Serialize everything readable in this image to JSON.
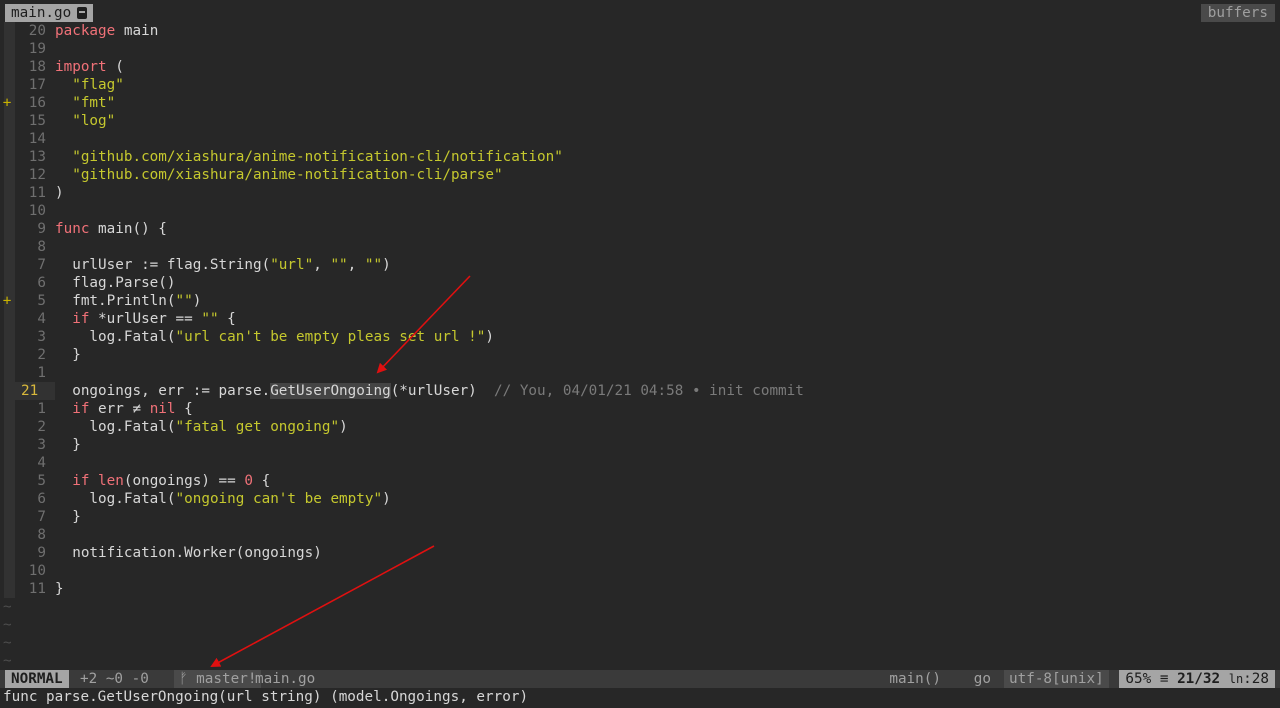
{
  "tabline": {
    "tab_label": "main.go",
    "buffers_label": "buffers"
  },
  "lines": [
    {
      "num": "20",
      "tokens": [
        {
          "t": "package",
          "c": "kw"
        },
        {
          "t": " main",
          "c": "fn"
        }
      ]
    },
    {
      "num": "19",
      "tokens": []
    },
    {
      "num": "18",
      "tokens": [
        {
          "t": "import",
          "c": "kw"
        },
        {
          "t": " (",
          "c": "fn"
        }
      ]
    },
    {
      "num": "17",
      "tokens": [
        {
          "t": "  ",
          "c": "fn"
        },
        {
          "t": "\"flag\"",
          "c": "str"
        }
      ]
    },
    {
      "num": "16",
      "sign": "+",
      "tokens": [
        {
          "t": "  ",
          "c": "fn"
        },
        {
          "t": "\"fmt\"",
          "c": "str"
        }
      ]
    },
    {
      "num": "15",
      "tokens": [
        {
          "t": "  ",
          "c": "fn"
        },
        {
          "t": "\"log\"",
          "c": "str"
        }
      ]
    },
    {
      "num": "14",
      "tokens": []
    },
    {
      "num": "13",
      "tokens": [
        {
          "t": "  ",
          "c": "fn"
        },
        {
          "t": "\"github.com/xiashura/anime-notification-cli/notification\"",
          "c": "str"
        }
      ]
    },
    {
      "num": "12",
      "tokens": [
        {
          "t": "  ",
          "c": "fn"
        },
        {
          "t": "\"github.com/xiashura/anime-notification-cli/parse\"",
          "c": "str"
        }
      ]
    },
    {
      "num": "11",
      "tokens": [
        {
          "t": ")",
          "c": "fn"
        }
      ]
    },
    {
      "num": "10",
      "tokens": []
    },
    {
      "num": "9",
      "tokens": [
        {
          "t": "func",
          "c": "kw"
        },
        {
          "t": " main() {",
          "c": "fn"
        }
      ]
    },
    {
      "num": "8",
      "tokens": []
    },
    {
      "num": "7",
      "tokens": [
        {
          "t": "  urlUser := flag.String(",
          "c": "fn"
        },
        {
          "t": "\"url\"",
          "c": "str"
        },
        {
          "t": ", ",
          "c": "fn"
        },
        {
          "t": "\"\"",
          "c": "str"
        },
        {
          "t": ", ",
          "c": "fn"
        },
        {
          "t": "\"\"",
          "c": "str"
        },
        {
          "t": ")",
          "c": "fn"
        }
      ]
    },
    {
      "num": "6",
      "tokens": [
        {
          "t": "  flag.Parse()",
          "c": "fn"
        }
      ]
    },
    {
      "num": "5",
      "sign": "+",
      "tokens": [
        {
          "t": "  fmt.Println(",
          "c": "fn"
        },
        {
          "t": "\"\"",
          "c": "str"
        },
        {
          "t": ")",
          "c": "fn"
        }
      ]
    },
    {
      "num": "4",
      "tokens": [
        {
          "t": "  ",
          "c": "fn"
        },
        {
          "t": "if",
          "c": "kw"
        },
        {
          "t": " *urlUser == ",
          "c": "fn"
        },
        {
          "t": "\"\"",
          "c": "str"
        },
        {
          "t": " {",
          "c": "fn"
        }
      ]
    },
    {
      "num": "3",
      "tokens": [
        {
          "t": "    log.Fatal(",
          "c": "fn"
        },
        {
          "t": "\"url can't be empty pleas set url !\"",
          "c": "str"
        },
        {
          "t": ")",
          "c": "fn"
        }
      ]
    },
    {
      "num": "2",
      "tokens": [
        {
          "t": "  }",
          "c": "fn"
        }
      ]
    },
    {
      "num": "1",
      "tokens": []
    },
    {
      "num": "21",
      "current": true,
      "tokens": [
        {
          "t": "  ongoings, err := parse.",
          "c": "fn"
        },
        {
          "t": "GetUserOngoing",
          "c": "fn hl-word"
        },
        {
          "t": "(*urlUser)  ",
          "c": "fn"
        },
        {
          "t": "// You, 04/01/21 04:58 • init commit",
          "c": "blame"
        }
      ]
    },
    {
      "num": "1",
      "tokens": [
        {
          "t": "  ",
          "c": "fn"
        },
        {
          "t": "if",
          "c": "kw"
        },
        {
          "t": " err ≠ ",
          "c": "fn"
        },
        {
          "t": "nil",
          "c": "kw"
        },
        {
          "t": " {",
          "c": "fn"
        }
      ]
    },
    {
      "num": "2",
      "tokens": [
        {
          "t": "    log.Fatal(",
          "c": "fn"
        },
        {
          "t": "\"fatal get ongoing\"",
          "c": "str"
        },
        {
          "t": ")",
          "c": "fn"
        }
      ]
    },
    {
      "num": "3",
      "tokens": [
        {
          "t": "  }",
          "c": "fn"
        }
      ]
    },
    {
      "num": "4",
      "tokens": []
    },
    {
      "num": "5",
      "tokens": [
        {
          "t": "  ",
          "c": "fn"
        },
        {
          "t": "if",
          "c": "kw"
        },
        {
          "t": " ",
          "c": "fn"
        },
        {
          "t": "len",
          "c": "kw"
        },
        {
          "t": "(ongoings) == ",
          "c": "fn"
        },
        {
          "t": "0",
          "c": "num-lit"
        },
        {
          "t": " {",
          "c": "fn"
        }
      ]
    },
    {
      "num": "6",
      "tokens": [
        {
          "t": "    log.Fatal(",
          "c": "fn"
        },
        {
          "t": "\"ongoing can't be empty\"",
          "c": "str"
        },
        {
          "t": ")",
          "c": "fn"
        }
      ]
    },
    {
      "num": "7",
      "tokens": [
        {
          "t": "  }",
          "c": "fn"
        }
      ]
    },
    {
      "num": "8",
      "tokens": []
    },
    {
      "num": "9",
      "tokens": [
        {
          "t": "  notification.Worker(ongoings)",
          "c": "fn"
        }
      ]
    },
    {
      "num": "10",
      "tokens": []
    },
    {
      "num": "11",
      "tokens": [
        {
          "t": "}",
          "c": "fn"
        }
      ]
    }
  ],
  "tilde_char": "~",
  "tilde_count": 4,
  "statusline": {
    "mode": "NORMAL",
    "git_stats": "+2 ~0 -0",
    "git_branch": "ᚠ master!",
    "filename": "main.go",
    "function": "main()",
    "filetype": "go",
    "encoding": "utf-8[unix]",
    "percent": "65%",
    "position": "21/32",
    "column_label": "ln",
    "column": ":28",
    "menu_glyph": "≡"
  },
  "cmdline": "func parse.GetUserOngoing(url string) (model.Ongoings, error)",
  "colors": {
    "background": "#272727",
    "keyword": "#f07178",
    "string": "#c5c82e",
    "current_line_number": "#d9b93c",
    "git_sign": "#c9b300",
    "annotation_arrow": "#e01010"
  }
}
